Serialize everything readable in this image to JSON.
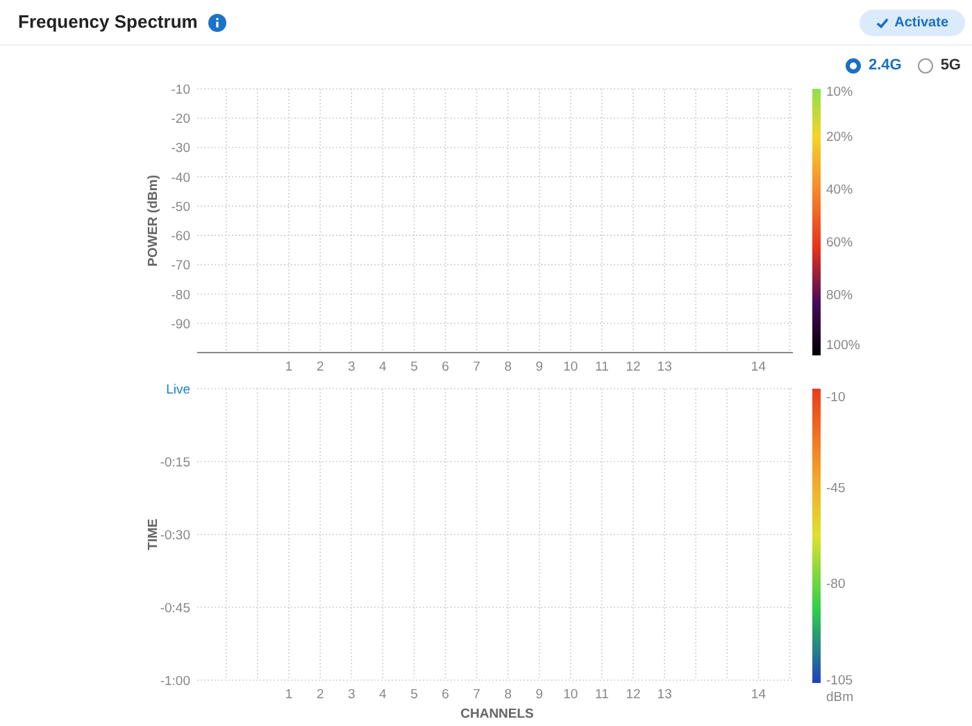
{
  "header": {
    "title": "Frequency Spectrum",
    "activate_button": "Activate"
  },
  "bands": [
    {
      "label": "2.4G",
      "selected": true
    },
    {
      "label": "5G",
      "selected": false
    }
  ],
  "power_chart": {
    "ylabel": "POWER (dBm)",
    "channel_labels": [
      "1",
      "2",
      "3",
      "4",
      "5",
      "6",
      "7",
      "8",
      "9",
      "10",
      "11",
      "12",
      "13",
      "14"
    ],
    "power_labels": [
      "-10",
      "-20",
      "-30",
      "-40",
      "-50",
      "-60",
      "-70",
      "-80",
      "-90"
    ],
    "scale_labels": [
      "10%",
      "20%",
      "40%",
      "60%",
      "80%",
      "100%"
    ]
  },
  "time_chart": {
    "xlabel": "CHANNELS",
    "ylabel": "TIME",
    "channel_labels": [
      "1",
      "2",
      "3",
      "4",
      "5",
      "6",
      "7",
      "8",
      "9",
      "10",
      "11",
      "12",
      "13",
      "14"
    ],
    "time_labels": [
      "Live",
      "-0:15",
      "-0:30",
      "-0:45",
      "-1:00"
    ],
    "scale_labels": [
      "-10",
      "-45",
      "-80",
      "-105"
    ],
    "scale_unit": "dBm"
  }
}
